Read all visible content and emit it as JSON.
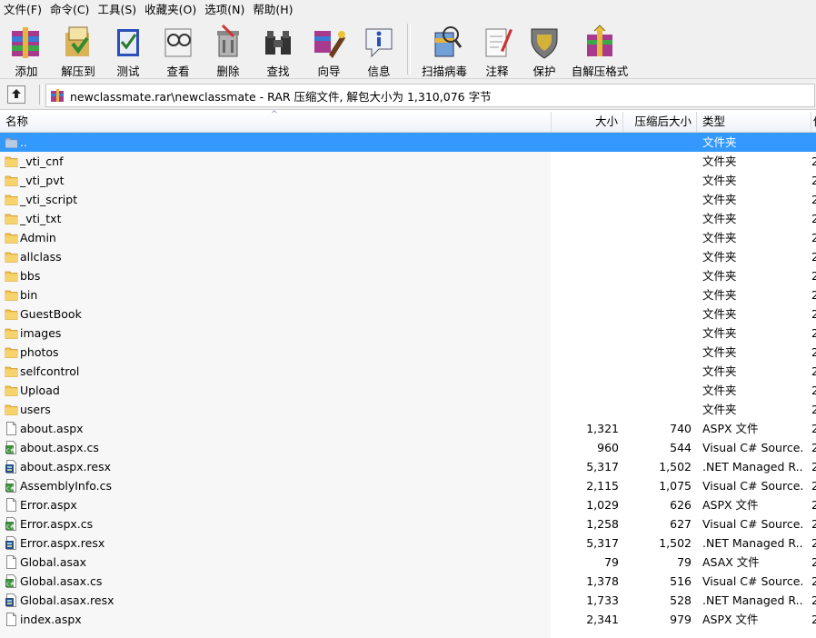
{
  "menu": [
    "文件(F)",
    "命令(C)",
    "工具(S)",
    "收藏夹(O)",
    "选项(N)",
    "帮助(H)"
  ],
  "toolbar": [
    {
      "label": "添加",
      "icon": "add-archive-icon"
    },
    {
      "label": "解压到",
      "icon": "extract-to-icon"
    },
    {
      "label": "测试",
      "icon": "test-icon"
    },
    {
      "label": "查看",
      "icon": "view-icon"
    },
    {
      "label": "删除",
      "icon": "delete-icon"
    },
    {
      "label": "查找",
      "icon": "find-binoculars-icon"
    },
    {
      "label": "向导",
      "icon": "wizard-icon"
    },
    {
      "label": "信息",
      "icon": "info-icon"
    },
    {
      "label": "扫描病毒",
      "icon": "virus-scan-icon"
    },
    {
      "label": "注释",
      "icon": "comment-icon"
    },
    {
      "label": "保护",
      "icon": "protect-shield-icon"
    },
    {
      "label": "自解压格式",
      "icon": "sfx-icon"
    }
  ],
  "address": "newclassmate.rar\\newclassmate - RAR 压缩文件, 解包大小为 1,310,076 字节",
  "columns": {
    "name": "名称",
    "size": "大小",
    "packed": "压缩后大小",
    "type": "类型",
    "extra": "修"
  },
  "files": [
    {
      "name": "..",
      "size": "",
      "packed": "",
      "type": "文件夹",
      "extra": "",
      "icon": "folder",
      "selected": true
    },
    {
      "name": "_vti_cnf",
      "size": "",
      "packed": "",
      "type": "文件夹",
      "extra": "2",
      "icon": "folder"
    },
    {
      "name": "_vti_pvt",
      "size": "",
      "packed": "",
      "type": "文件夹",
      "extra": "2",
      "icon": "folder"
    },
    {
      "name": "_vti_script",
      "size": "",
      "packed": "",
      "type": "文件夹",
      "extra": "2",
      "icon": "folder"
    },
    {
      "name": "_vti_txt",
      "size": "",
      "packed": "",
      "type": "文件夹",
      "extra": "2",
      "icon": "folder"
    },
    {
      "name": "Admin",
      "size": "",
      "packed": "",
      "type": "文件夹",
      "extra": "2",
      "icon": "folder"
    },
    {
      "name": "allclass",
      "size": "",
      "packed": "",
      "type": "文件夹",
      "extra": "2",
      "icon": "folder"
    },
    {
      "name": "bbs",
      "size": "",
      "packed": "",
      "type": "文件夹",
      "extra": "2",
      "icon": "folder"
    },
    {
      "name": "bin",
      "size": "",
      "packed": "",
      "type": "文件夹",
      "extra": "2",
      "icon": "folder"
    },
    {
      "name": "GuestBook",
      "size": "",
      "packed": "",
      "type": "文件夹",
      "extra": "2",
      "icon": "folder"
    },
    {
      "name": "images",
      "size": "",
      "packed": "",
      "type": "文件夹",
      "extra": "2",
      "icon": "folder"
    },
    {
      "name": "photos",
      "size": "",
      "packed": "",
      "type": "文件夹",
      "extra": "2",
      "icon": "folder"
    },
    {
      "name": "selfcontrol",
      "size": "",
      "packed": "",
      "type": "文件夹",
      "extra": "2",
      "icon": "folder"
    },
    {
      "name": "Upload",
      "size": "",
      "packed": "",
      "type": "文件夹",
      "extra": "2",
      "icon": "folder"
    },
    {
      "name": "users",
      "size": "",
      "packed": "",
      "type": "文件夹",
      "extra": "2",
      "icon": "folder"
    },
    {
      "name": "about.aspx",
      "size": "1,321",
      "packed": "740",
      "type": "ASPX 文件",
      "extra": "2",
      "icon": "file"
    },
    {
      "name": "about.aspx.cs",
      "size": "960",
      "packed": "544",
      "type": "Visual C# Source...",
      "extra": "2",
      "icon": "cs"
    },
    {
      "name": "about.aspx.resx",
      "size": "5,317",
      "packed": "1,502",
      "type": ".NET Managed R...",
      "extra": "2",
      "icon": "resx"
    },
    {
      "name": "AssemblyInfo.cs",
      "size": "2,115",
      "packed": "1,075",
      "type": "Visual C# Source...",
      "extra": "2",
      "icon": "cs"
    },
    {
      "name": "Error.aspx",
      "size": "1,029",
      "packed": "626",
      "type": "ASPX 文件",
      "extra": "2",
      "icon": "file"
    },
    {
      "name": "Error.aspx.cs",
      "size": "1,258",
      "packed": "627",
      "type": "Visual C# Source...",
      "extra": "2",
      "icon": "cs"
    },
    {
      "name": "Error.aspx.resx",
      "size": "5,317",
      "packed": "1,502",
      "type": ".NET Managed R...",
      "extra": "2",
      "icon": "resx"
    },
    {
      "name": "Global.asax",
      "size": "79",
      "packed": "79",
      "type": "ASAX 文件",
      "extra": "2",
      "icon": "file"
    },
    {
      "name": "Global.asax.cs",
      "size": "1,378",
      "packed": "516",
      "type": "Visual C# Source...",
      "extra": "2",
      "icon": "cs"
    },
    {
      "name": "Global.asax.resx",
      "size": "1,733",
      "packed": "528",
      "type": ".NET Managed R...",
      "extra": "2",
      "icon": "resx"
    },
    {
      "name": "index.aspx",
      "size": "2,341",
      "packed": "979",
      "type": "ASPX 文件",
      "extra": "2",
      "icon": "file"
    }
  ],
  "colors": {
    "selection": "#3399ff",
    "folder": "#f3c14a",
    "toolbar_bg": "#f0f0f0"
  }
}
